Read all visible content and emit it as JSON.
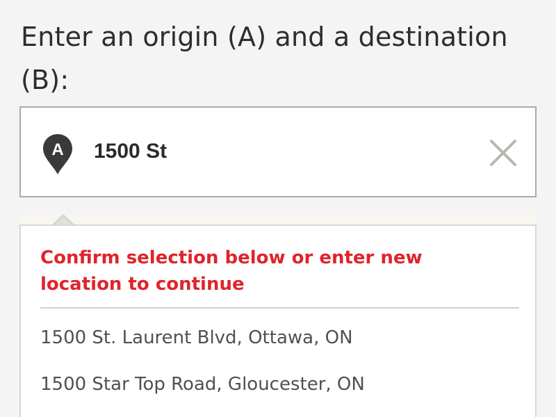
{
  "heading": "Enter an origin (A) and a destination (B):",
  "origin_input": {
    "value": "1500 St",
    "marker_letter": "A",
    "clear_icon": "close-icon"
  },
  "suggestions": {
    "warning": "Confirm selection below or enter new location to continue",
    "items": [
      {
        "label": "1500 St. Laurent Blvd, Ottawa, ON"
      },
      {
        "label": "1500 Star Top Road, Gloucester, ON"
      }
    ]
  },
  "colors": {
    "background": "#f3f4f3",
    "warning_red": "#e0242b",
    "marker": "#3a3a3a",
    "clear_icon": "#b9b6ad"
  }
}
